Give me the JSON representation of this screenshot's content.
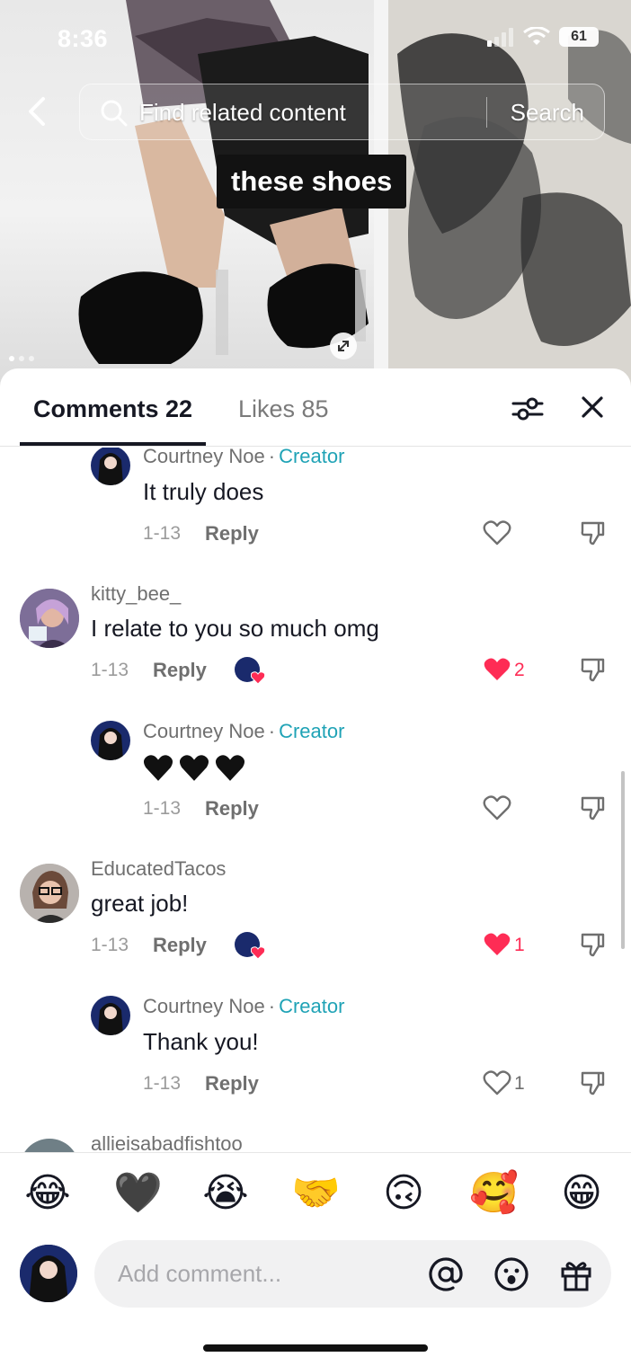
{
  "status": {
    "time": "8:36",
    "battery": "61"
  },
  "search": {
    "placeholder": "Find related content",
    "button": "Search"
  },
  "video": {
    "caption": "these shoes"
  },
  "tabs": {
    "comments": "Comments 22",
    "likes": "Likes 85"
  },
  "comments": [
    {
      "user": "Courtney Noe",
      "sep": "·",
      "badge": "Creator",
      "text": "It truly does",
      "date": "1-13",
      "reply": "Reply",
      "likes": ""
    },
    {
      "user": "kitty_bee_",
      "text": "I relate to you so much omg",
      "date": "1-13",
      "reply": "Reply",
      "likes": "2",
      "liked": true
    },
    {
      "user": "Courtney Noe",
      "sep": "·",
      "badge": "Creator",
      "text": "🖤🖤🖤",
      "date": "1-13",
      "reply": "Reply",
      "likes": ""
    },
    {
      "user": "EducatedTacos",
      "text": "great job!",
      "date": "1-13",
      "reply": "Reply",
      "likes": "1",
      "liked": true
    },
    {
      "user": "Courtney Noe",
      "sep": "·",
      "badge": "Creator",
      "text": "Thank you!",
      "date": "1-13",
      "reply": "Reply",
      "likes": "1"
    },
    {
      "user": "allieisabadfishtoo"
    }
  ],
  "emoji_bar": [
    "😂",
    "🖤",
    "😭",
    "🤝",
    "🙃",
    "🥰",
    "😁"
  ],
  "composer": {
    "placeholder": "Add comment..."
  },
  "colors": {
    "accent_teal": "#20a3b6",
    "heart_red": "#fe2c55",
    "text_dark": "#161823"
  }
}
